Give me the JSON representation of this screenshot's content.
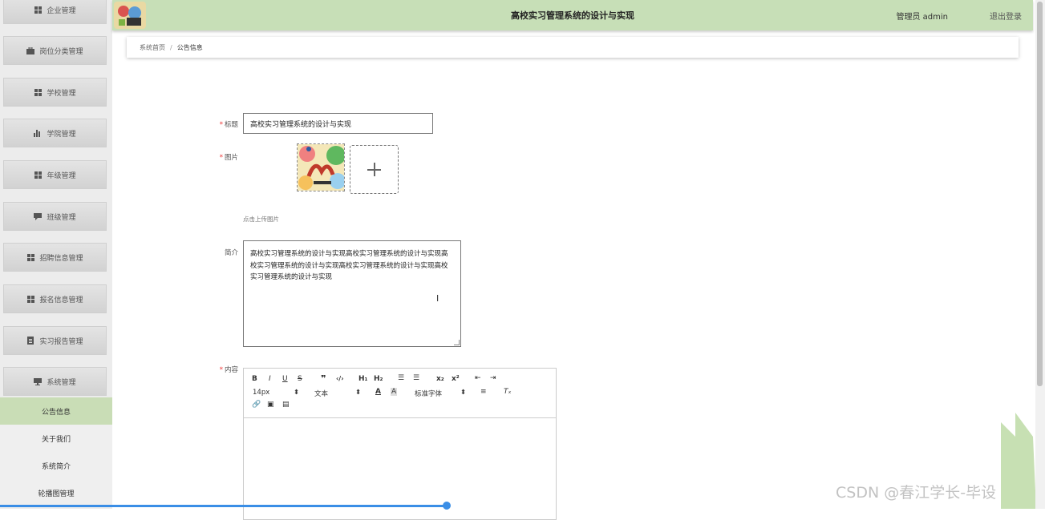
{
  "header": {
    "title": "高校实习管理系统的设计与实现",
    "user_label": "管理员 admin",
    "logout_label": "退出登录"
  },
  "sidebar": {
    "items": [
      {
        "label": "企业管理",
        "icon": "grid-icon"
      },
      {
        "label": "岗位分类管理",
        "icon": "briefcase-icon"
      },
      {
        "label": "学校管理",
        "icon": "grid-icon"
      },
      {
        "label": "学院管理",
        "icon": "bar-chart-icon"
      },
      {
        "label": "年级管理",
        "icon": "grid-icon"
      },
      {
        "label": "班级管理",
        "icon": "comment-icon"
      },
      {
        "label": "招聘信息管理",
        "icon": "grid-icon"
      },
      {
        "label": "报名信息管理",
        "icon": "grid-icon"
      },
      {
        "label": "实习报告管理",
        "icon": "file-icon"
      },
      {
        "label": "系统管理",
        "icon": "monitor-icon"
      }
    ],
    "sub_items": [
      {
        "label": "公告信息",
        "active": true
      },
      {
        "label": "关于我们",
        "active": false
      },
      {
        "label": "系统简介",
        "active": false
      },
      {
        "label": "轮播图管理",
        "active": false
      }
    ]
  },
  "breadcrumb": {
    "home": "系统首页",
    "separator": "/",
    "current": "公告信息"
  },
  "form": {
    "title_label": "标题",
    "title_value": "高校实习管理系统的设计与实现",
    "image_label": "图片",
    "upload_hint": "点击上传图片",
    "intro_label": "简介",
    "intro_value": "高校实习管理系统的设计与实现高校实习管理系统的设计与实现高校实习管理系统的设计与实现高校实习管理系统的设计与实现高校实习管理系统的设计与实现",
    "content_label": "内容",
    "required_mark": "*"
  },
  "editor": {
    "font_size": "14px",
    "header_select": "文本",
    "font_family": "标准字体"
  },
  "watermark": "CSDN @春江学长-毕设",
  "colors": {
    "header_bg": "#c7dfb7",
    "active_sub_bg": "#c9ddb6",
    "required": "#e33333",
    "progress": "#3a8ee6"
  }
}
